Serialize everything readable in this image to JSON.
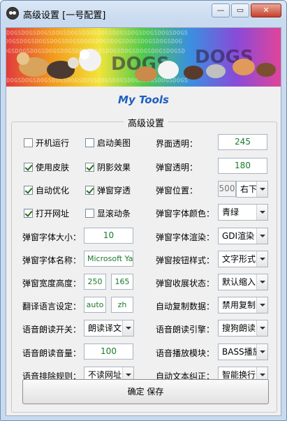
{
  "window": {
    "title": "高级设置  [一号配置]"
  },
  "titlebar": {
    "min_label": "—",
    "max_label": "▭",
    "close_label": "✕"
  },
  "banner": {
    "caption": "My Tools",
    "watermark": "DOGS DOGS DOGS DOGS"
  },
  "group": {
    "title": "高级设置"
  },
  "checkboxes": [
    {
      "label": "开机运行",
      "checked": false
    },
    {
      "label": "启动美图",
      "checked": false
    },
    {
      "label": "使用皮肤",
      "checked": true
    },
    {
      "label": "阴影效果",
      "checked": true
    },
    {
      "label": "自动优化",
      "checked": true
    },
    {
      "label": "弹窗穿透",
      "checked": true
    },
    {
      "label": "打开网址",
      "checked": true
    },
    {
      "label": "显滚动条",
      "checked": false
    }
  ],
  "right": {
    "opacity_label": "界面透明：",
    "opacity_value": "245",
    "popup_opacity_label": "弹窗透明：",
    "popup_opacity_value": "180",
    "popup_pos_label": "弹窗位置：",
    "popup_pos_num": "500",
    "popup_pos_value": "右下",
    "font_color_label": "弹窗字体颜色：",
    "font_color_value": "青绿",
    "font_render_label": "弹窗字体渲染：",
    "font_render_value": "GDI渲染",
    "button_style_label": "弹窗按钮样式：",
    "button_style_value": "文字形式",
    "collapse_label": "弹窗收展状态：",
    "collapse_value": "默认缩入",
    "copy_label": "自动复制数据：",
    "copy_value": "禁用复制",
    "tts_engine_label": "语音朗读引擎：",
    "tts_engine_value": "搜狗朗读",
    "audio_module_label": "语音播放模块：",
    "audio_module_value": "BASS播放",
    "correct_label": "自动文本纠正：",
    "correct_value": "智能换行"
  },
  "left": {
    "font_size_label": "弹窗字体大小：",
    "font_size_value": "10",
    "font_name_label": "弹窗字体名称：",
    "font_name_value": "Microsoft Yahe",
    "size_label": "弹窗宽度高度：",
    "width_value": "250",
    "height_value": "165",
    "translate_label": "翻译语言设定：",
    "src_lang": "auto",
    "dst_lang": "zh",
    "tts_switch_label": "语音朗读开关：",
    "tts_switch_value": "朗读译文",
    "volume_label": "语音朗读音量：",
    "volume_value": "100",
    "exclude_label": "语音排除规则：",
    "exclude_value": "不读网址"
  },
  "save_button": {
    "label": "确定 保存"
  }
}
